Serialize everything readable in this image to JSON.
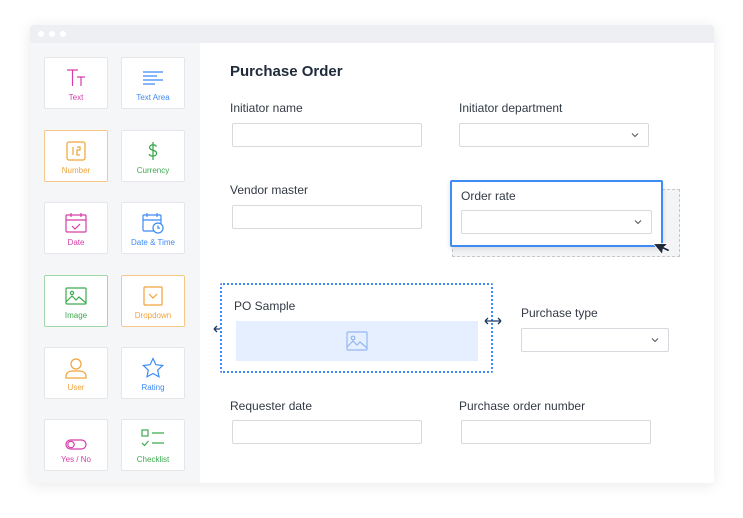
{
  "palette": {
    "items": [
      {
        "label": "Text",
        "icon": "text-icon",
        "color": "#d63ca8"
      },
      {
        "label": "Text Area",
        "icon": "text-area-icon",
        "color": "#3d8bf5"
      },
      {
        "label": "Number",
        "icon": "number-icon",
        "color": "#f1a33a"
      },
      {
        "label": "Currency",
        "icon": "currency-icon",
        "color": "#3caa4e"
      },
      {
        "label": "Date",
        "icon": "date-icon",
        "color": "#d63ca8"
      },
      {
        "label": "Date & Time",
        "icon": "date-time-icon",
        "color": "#3d8bf5"
      },
      {
        "label": "Image",
        "icon": "image-icon",
        "color": "#3caa4e"
      },
      {
        "label": "Dropdown",
        "icon": "dropdown-icon",
        "color": "#f1a33a"
      },
      {
        "label": "User",
        "icon": "user-icon",
        "color": "#f1a33a"
      },
      {
        "label": "Rating",
        "icon": "star-icon",
        "color": "#3d8bf5"
      },
      {
        "label": "Yes / No",
        "icon": "toggle-icon",
        "color": "#d63ca8"
      },
      {
        "label": "Checklist",
        "icon": "checklist-icon",
        "color": "#3caa4e"
      }
    ]
  },
  "form": {
    "title": "Purchase Order",
    "fields": {
      "initiator_name": "Initiator name",
      "initiator_department": "Initiator department",
      "vendor_master": "Vendor master",
      "order_rate": "Order rate",
      "po_sample": "PO Sample",
      "purchase_type": "Purchase type",
      "requester_date": "Requester date",
      "purchase_order_number": "Purchase order number"
    }
  },
  "colors": {
    "accent": "#3d8bf5",
    "image_placeholder": "#e6efff",
    "title": "#1f2a3a"
  }
}
